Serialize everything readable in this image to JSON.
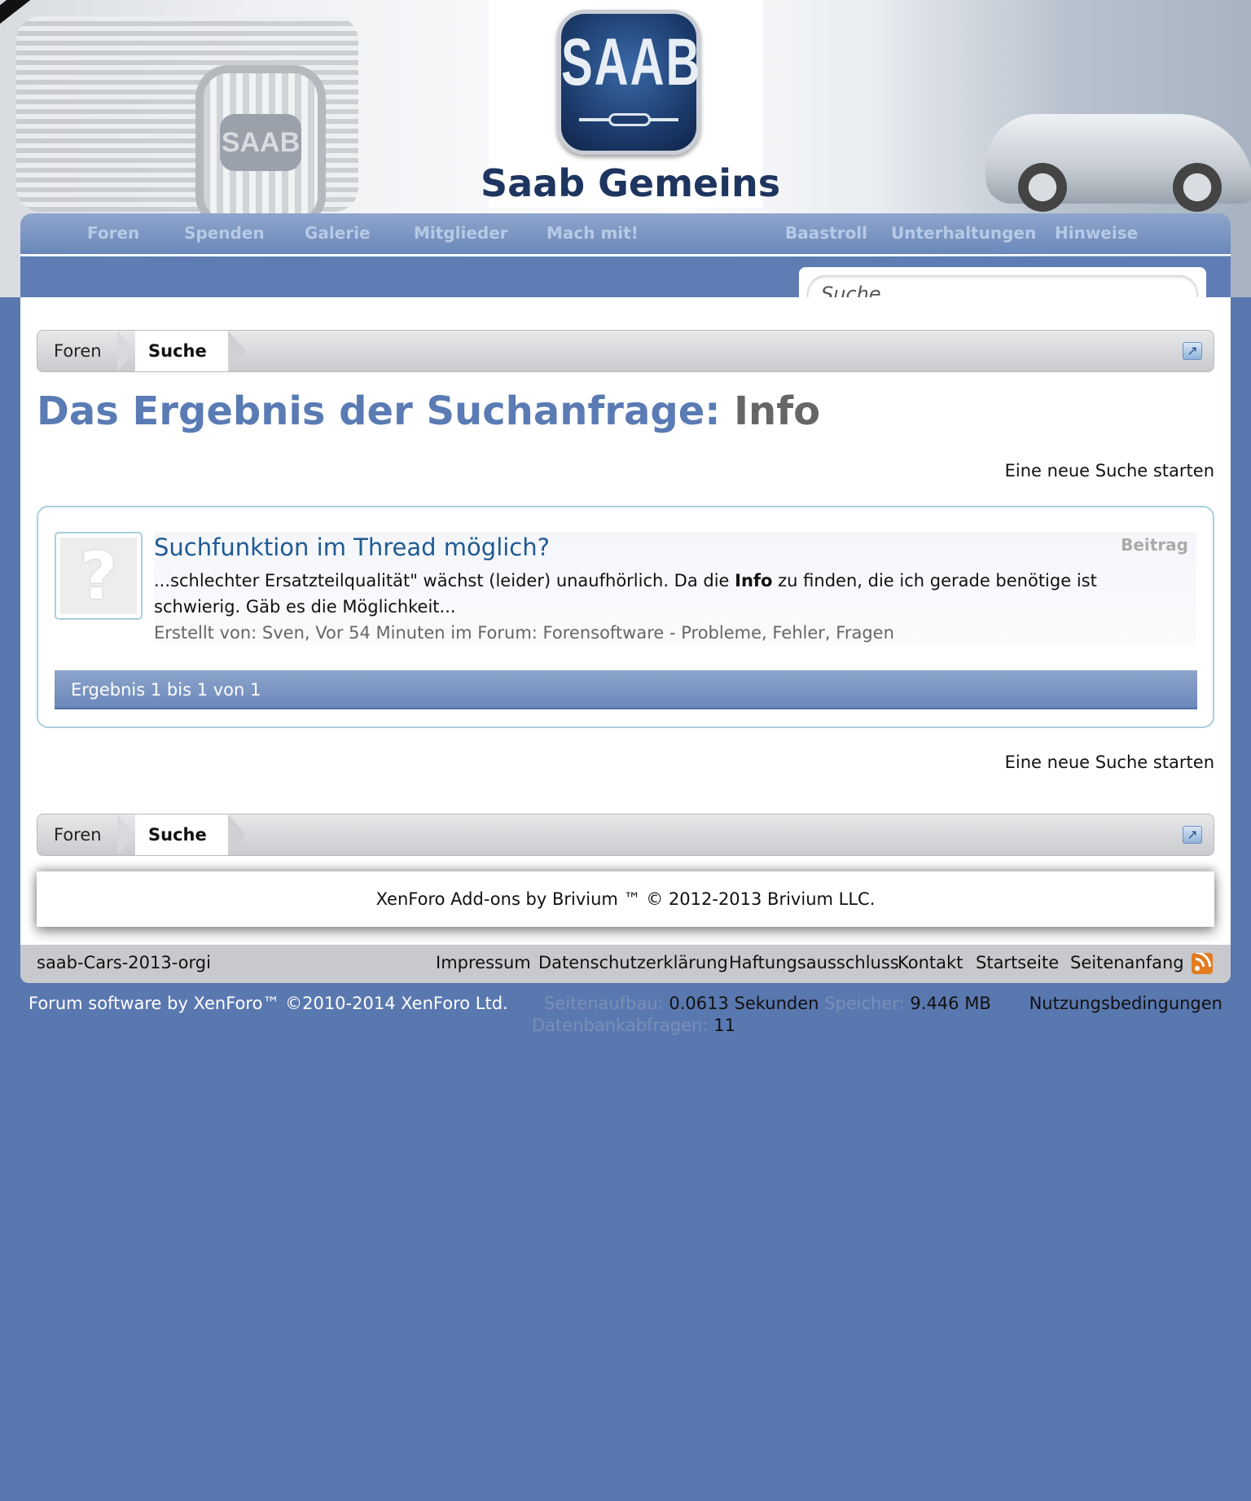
{
  "header": {
    "logo_badge_text": "SAAB",
    "site_name": "Saab Gemeins",
    "grille_badge_text": "SAAB"
  },
  "nav": {
    "items": [
      {
        "label": "Foren"
      },
      {
        "label": "Spenden"
      },
      {
        "label": "Galerie"
      },
      {
        "label": "Mitglieder"
      },
      {
        "label": "Mach mit!"
      },
      {
        "label": "Baastroll"
      },
      {
        "label": "Unterhaltungen"
      },
      {
        "label": "Hinweise"
      }
    ]
  },
  "search": {
    "placeholder": "Suche…"
  },
  "breadcrumb": {
    "home": "Foren",
    "current": "Suche"
  },
  "page": {
    "title_prefix": "Das Ergebnis der Suchanfrage:",
    "search_term": "Info",
    "new_search": "Eine neue Suche starten"
  },
  "results": [
    {
      "title": "Suchfunktion im Thread möglich?",
      "type": "Beitrag",
      "snippet_before": "...schlechter Ersatzteilqualität\" wächst (leider) unaufhörlich. Da die ",
      "snippet_highlight": "Info",
      "snippet_after": " zu finden, die ich gerade benötige ist schwierig. Gäb es die Möglichkeit...",
      "meta": "Erstellt von: Sven, Vor 54 Minuten im Forum: Forensoftware - Probleme, Fehler, Fragen"
    }
  ],
  "results_footer": "Ergebnis 1 bis 1 von 1",
  "copyright": "XenForo Add-ons by Brivium ™ © 2012-2013 Brivium LLC.",
  "footer": {
    "style_name": "saab-Cars-2013-orgi",
    "links": [
      {
        "label": "Impressum"
      },
      {
        "label": "Datenschutzerklärung"
      },
      {
        "label": "Haftungsausschluss"
      },
      {
        "label": "Kontakt"
      },
      {
        "label": "Startseite"
      },
      {
        "label": "Seitenanfang"
      }
    ],
    "rss_icon": "rss-icon"
  },
  "bottom": {
    "forum_software": "Forum software by XenForo™ ©2010-2014 XenForo Ltd.",
    "load_label": "Seitenaufbau:",
    "load_value": "0.0613 Sekunden",
    "memory_label": "Speicher:",
    "memory_value": "9.446 MB",
    "queries_label": "Datenbankabfragen:",
    "queries_value": "11",
    "terms": "Nutzungsbedingungen"
  },
  "colors": {
    "page_background": "#5a78b0",
    "nav_gradient_top": "#8ea5cb",
    "title_blue": "#5a7bb4",
    "link_blue": "#1f5a93",
    "result_border": "#a9cfe0"
  }
}
